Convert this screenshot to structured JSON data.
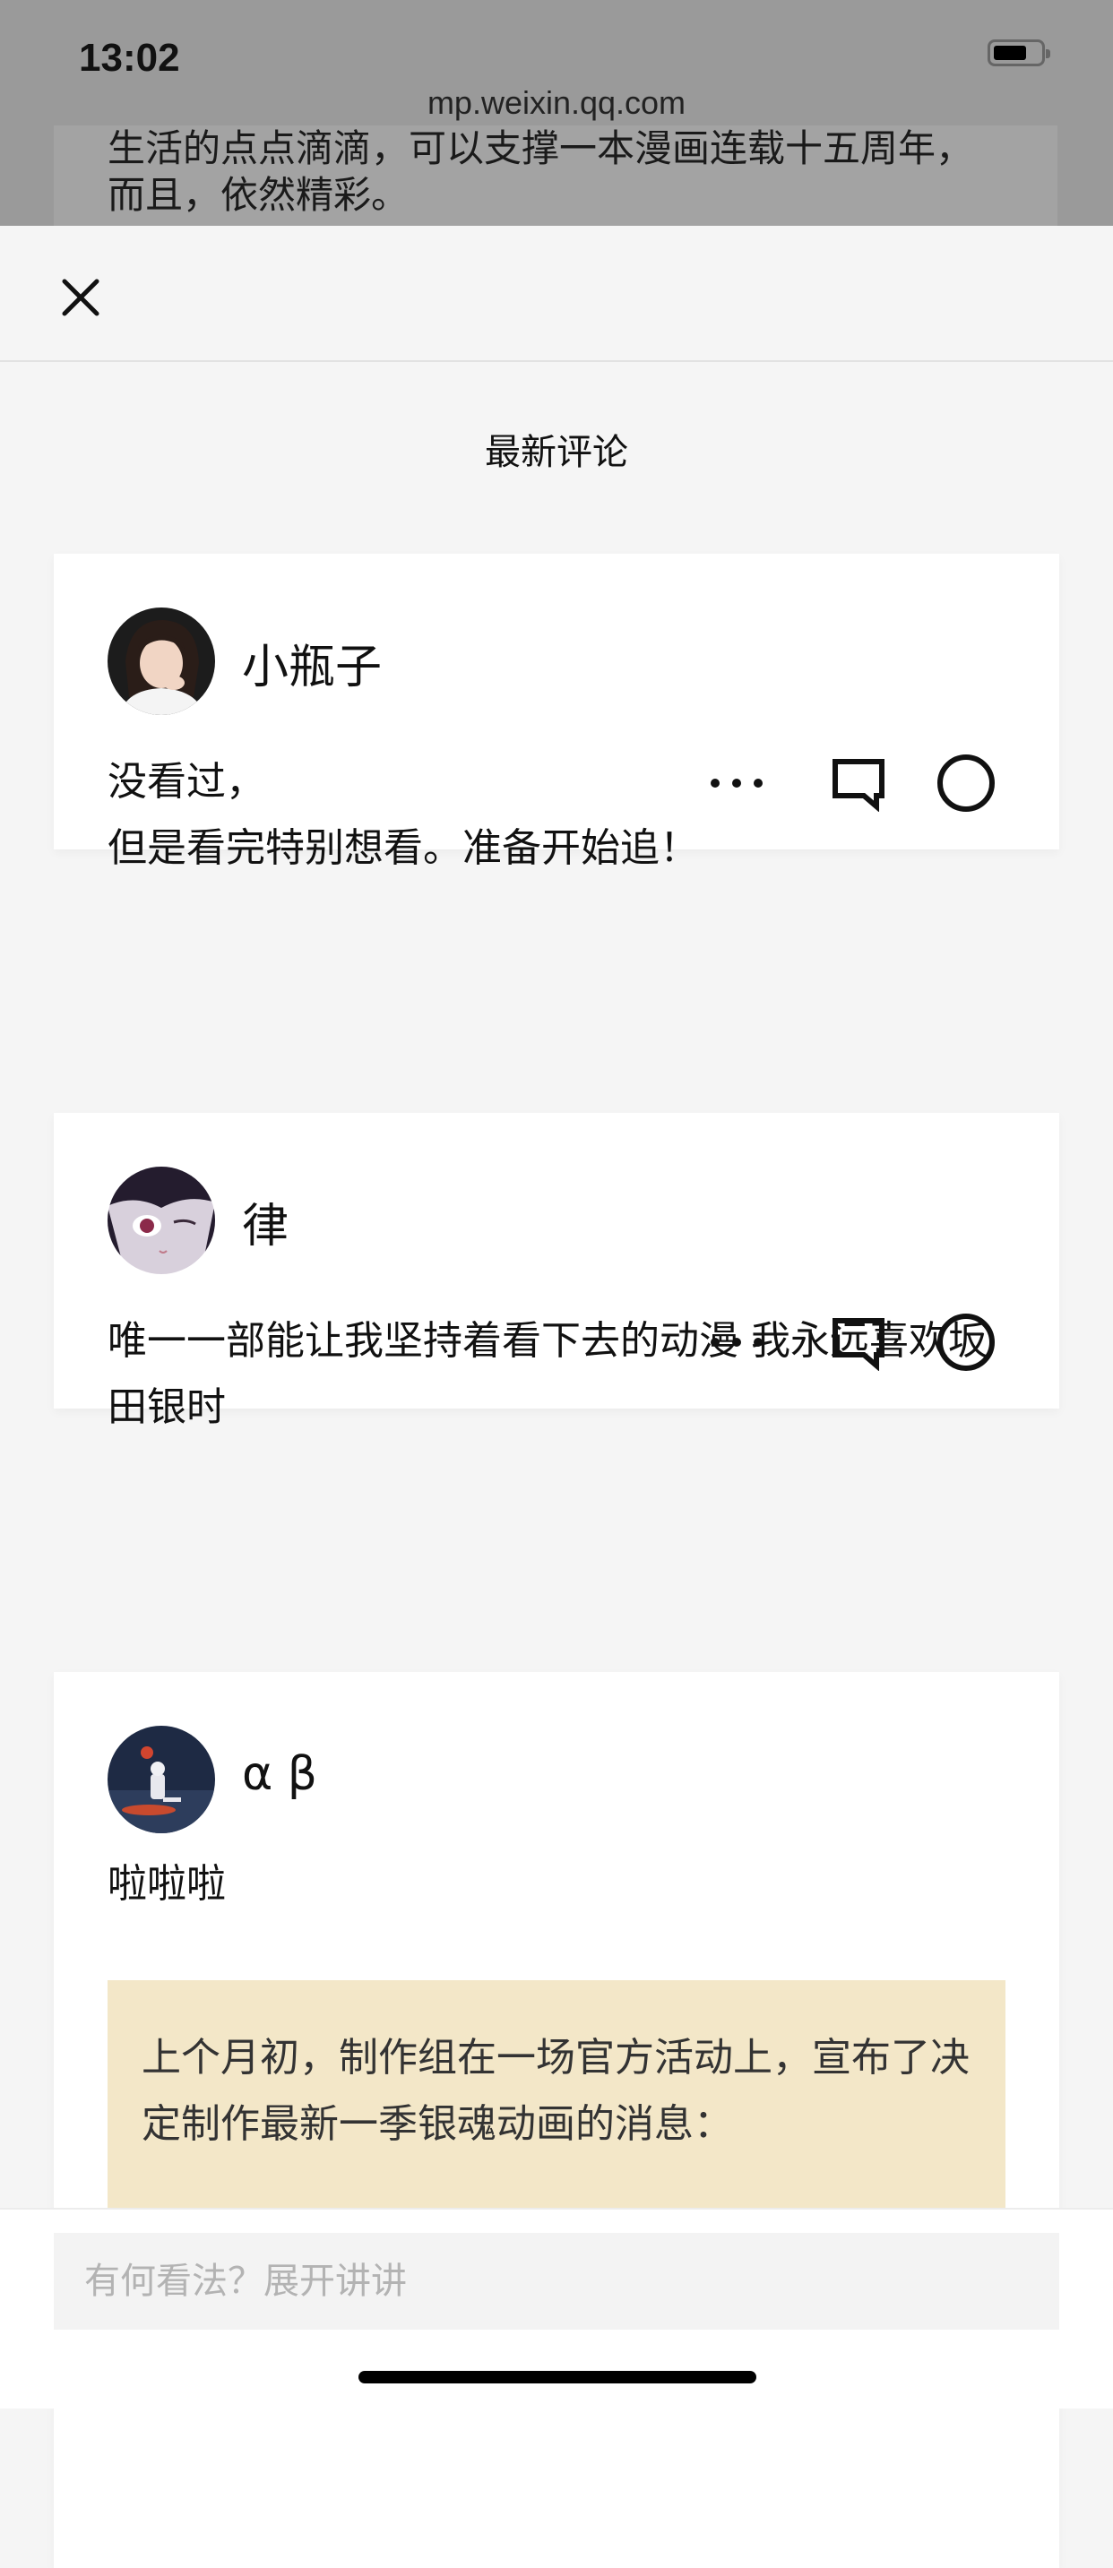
{
  "status_bar": {
    "time": "13:02",
    "battery_icon": "battery-icon"
  },
  "browser": {
    "url": "mp.weixin.qq.com"
  },
  "background_article": {
    "text": "生活的点点滴滴，可以支撑一本漫画连载十五周年，而且，依然精彩。"
  },
  "sheet": {
    "close_icon": "close-icon",
    "title": "最新评论"
  },
  "comments": [
    {
      "username": "小瓶子",
      "text": "没看过，\n但是看完特别想看。准备开始追！",
      "actions": [
        "more-icon",
        "reply-icon",
        "like-icon"
      ]
    },
    {
      "username": "律",
      "text": "唯一一部能让我坚持着看下去的动漫 我永远喜欢坂田银时",
      "actions": [
        "more-icon",
        "reply-icon",
        "like-icon"
      ]
    },
    {
      "username": "α β",
      "text": "啦啦啦",
      "quote": "上个月初，制作组在一场官方活动上，宣布了决定制作最新一季银魂动画的消息："
    }
  ],
  "bottom_bar": {
    "placeholder": "有何看法？展开讲讲"
  },
  "colors": {
    "sheet_background": "#f5f5f5",
    "card_background": "#ffffff",
    "quote_background": "#f3e7c8",
    "overlay_background": "#9a9a9a"
  }
}
